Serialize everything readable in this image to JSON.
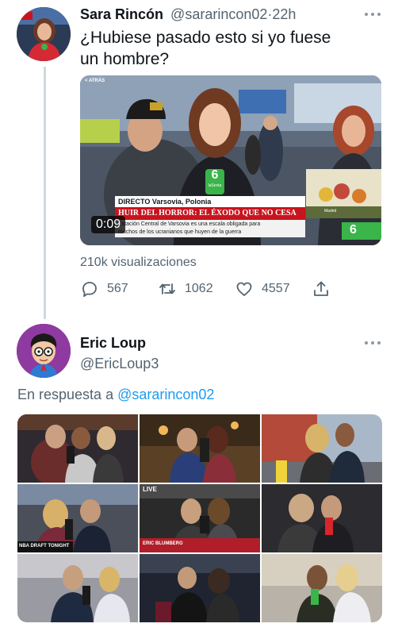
{
  "tweet": {
    "author_name": "Sara Rincón",
    "author_handle": "@sararincon02",
    "separator": "·",
    "time": "22h",
    "text": "¿Hubiese pasado esto si yo fuese un hombre?",
    "video": {
      "corner_label": "< ATRÁS",
      "live_location": "DIRECTO Varsovia, Polonia",
      "headline": "HUIR DEL HORROR: EL ÉXODO QUE NO CESA",
      "subline_1": "Estación Central de Varsovia es una escala obligada para",
      "subline_2": "muchos de los ucranianos que huyen de la guerra",
      "channel_mark": "6",
      "channel_name": "laSexta",
      "inset_caption": "Madrid",
      "timestamp": "0:09"
    },
    "views": "210k visualizaciones",
    "actions": {
      "replies": "567",
      "retweets": "1062",
      "likes": "4557"
    }
  },
  "reply": {
    "author_name": "Eric Loup",
    "author_handle": "@EricLoup3",
    "reply_prefix": "En respuesta a",
    "reply_mention": "@sararincon02",
    "image_captions": {
      "nba": "NBA DRAFT TONIGHT",
      "live": "LIVE",
      "eric": "ERIC BLUMBERG"
    }
  },
  "colors": {
    "text": "#0f1419",
    "muted": "#536471",
    "link": "#1d9bf0",
    "channel_green": "#39b54a",
    "headline_red": "#c8141e"
  },
  "icons": [
    "reply-icon",
    "retweet-icon",
    "like-icon",
    "share-icon",
    "more-icon"
  ]
}
